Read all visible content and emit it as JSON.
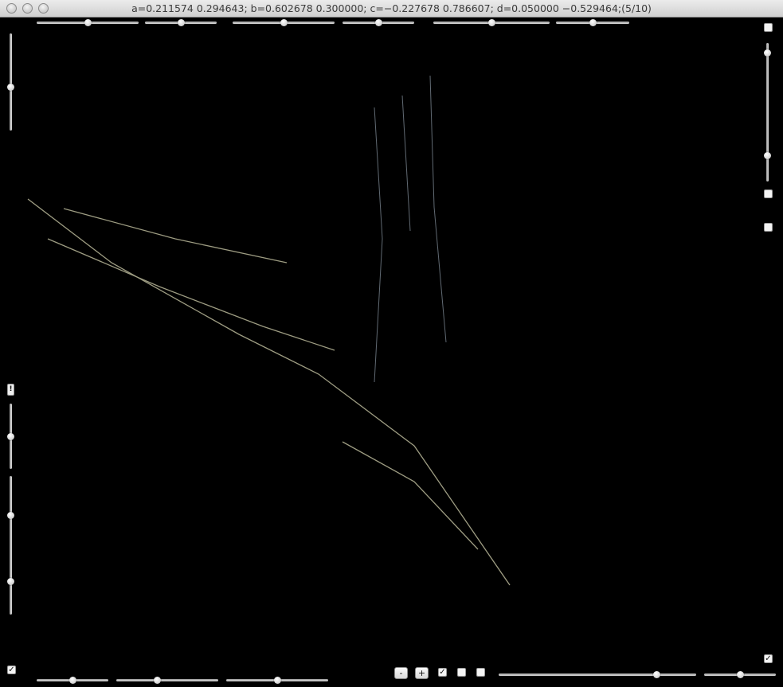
{
  "window": {
    "title": "a=0.211574 0.294643; b=0.602678 0.300000; c=−0.227678 0.786607; d=0.050000 −0.529464;(5/10)"
  },
  "controls": {
    "minus_label": "-",
    "plus_label": "+",
    "checkmark": "✓",
    "alert_label": "!",
    "top_sliders": [
      0.5,
      0.5,
      0.5,
      0.5,
      0.5,
      0.5
    ],
    "bottom_sliders": [
      0.5,
      0.4,
      0.5,
      0.8,
      0.5
    ],
    "left_sliders": [
      0.45,
      0.5,
      0.5,
      0.5
    ],
    "right_sliders": [
      0.9,
      0.5
    ],
    "checkboxes": {
      "right_top": false,
      "right_second": false,
      "right_third": false,
      "left_bottom": true,
      "right_bottom": true,
      "bottom_1": true,
      "bottom_2": false,
      "bottom_3": false
    }
  },
  "colors": {
    "background": "#000000",
    "green": "#7cf05a",
    "violet": "#b07cf0",
    "cyan": "#7ed6d8",
    "salmon": "#c8706a",
    "cream": "#d7d7a8"
  }
}
